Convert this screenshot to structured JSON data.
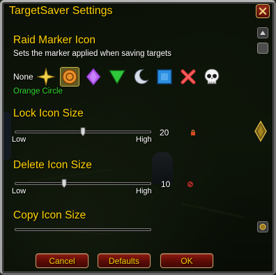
{
  "window": {
    "title": "TargetSaver Settings"
  },
  "raid_marker": {
    "heading": "Raid Marker Icon",
    "description": "Sets the marker applied when saving targets",
    "none_label": "None",
    "selected_name": "Orange Circle",
    "markers": [
      {
        "icon": "star-icon",
        "color": "#f2d14a"
      },
      {
        "icon": "circle-icon",
        "color": "#e8902a",
        "selected": true
      },
      {
        "icon": "diamond-icon",
        "color": "#b45cf0"
      },
      {
        "icon": "triangle-icon",
        "color": "#2ec83a"
      },
      {
        "icon": "moon-icon",
        "color": "#d6dde8"
      },
      {
        "icon": "square-icon",
        "color": "#2a8ee0"
      },
      {
        "icon": "cross-icon",
        "color": "#e83a3a"
      },
      {
        "icon": "skull-icon",
        "color": "#f2f2f2"
      }
    ]
  },
  "lock_size": {
    "heading": "Lock Icon Size",
    "low": "Low",
    "high": "High",
    "value": "20",
    "fraction": 0.5
  },
  "delete_size": {
    "heading": "Delete Icon Size",
    "low": "Low",
    "high": "High",
    "value": "10",
    "fraction": 0.36
  },
  "copy_size": {
    "heading": "Copy Icon Size"
  },
  "buttons": {
    "cancel": "Cancel",
    "defaults": "Defaults",
    "ok": "OK"
  }
}
